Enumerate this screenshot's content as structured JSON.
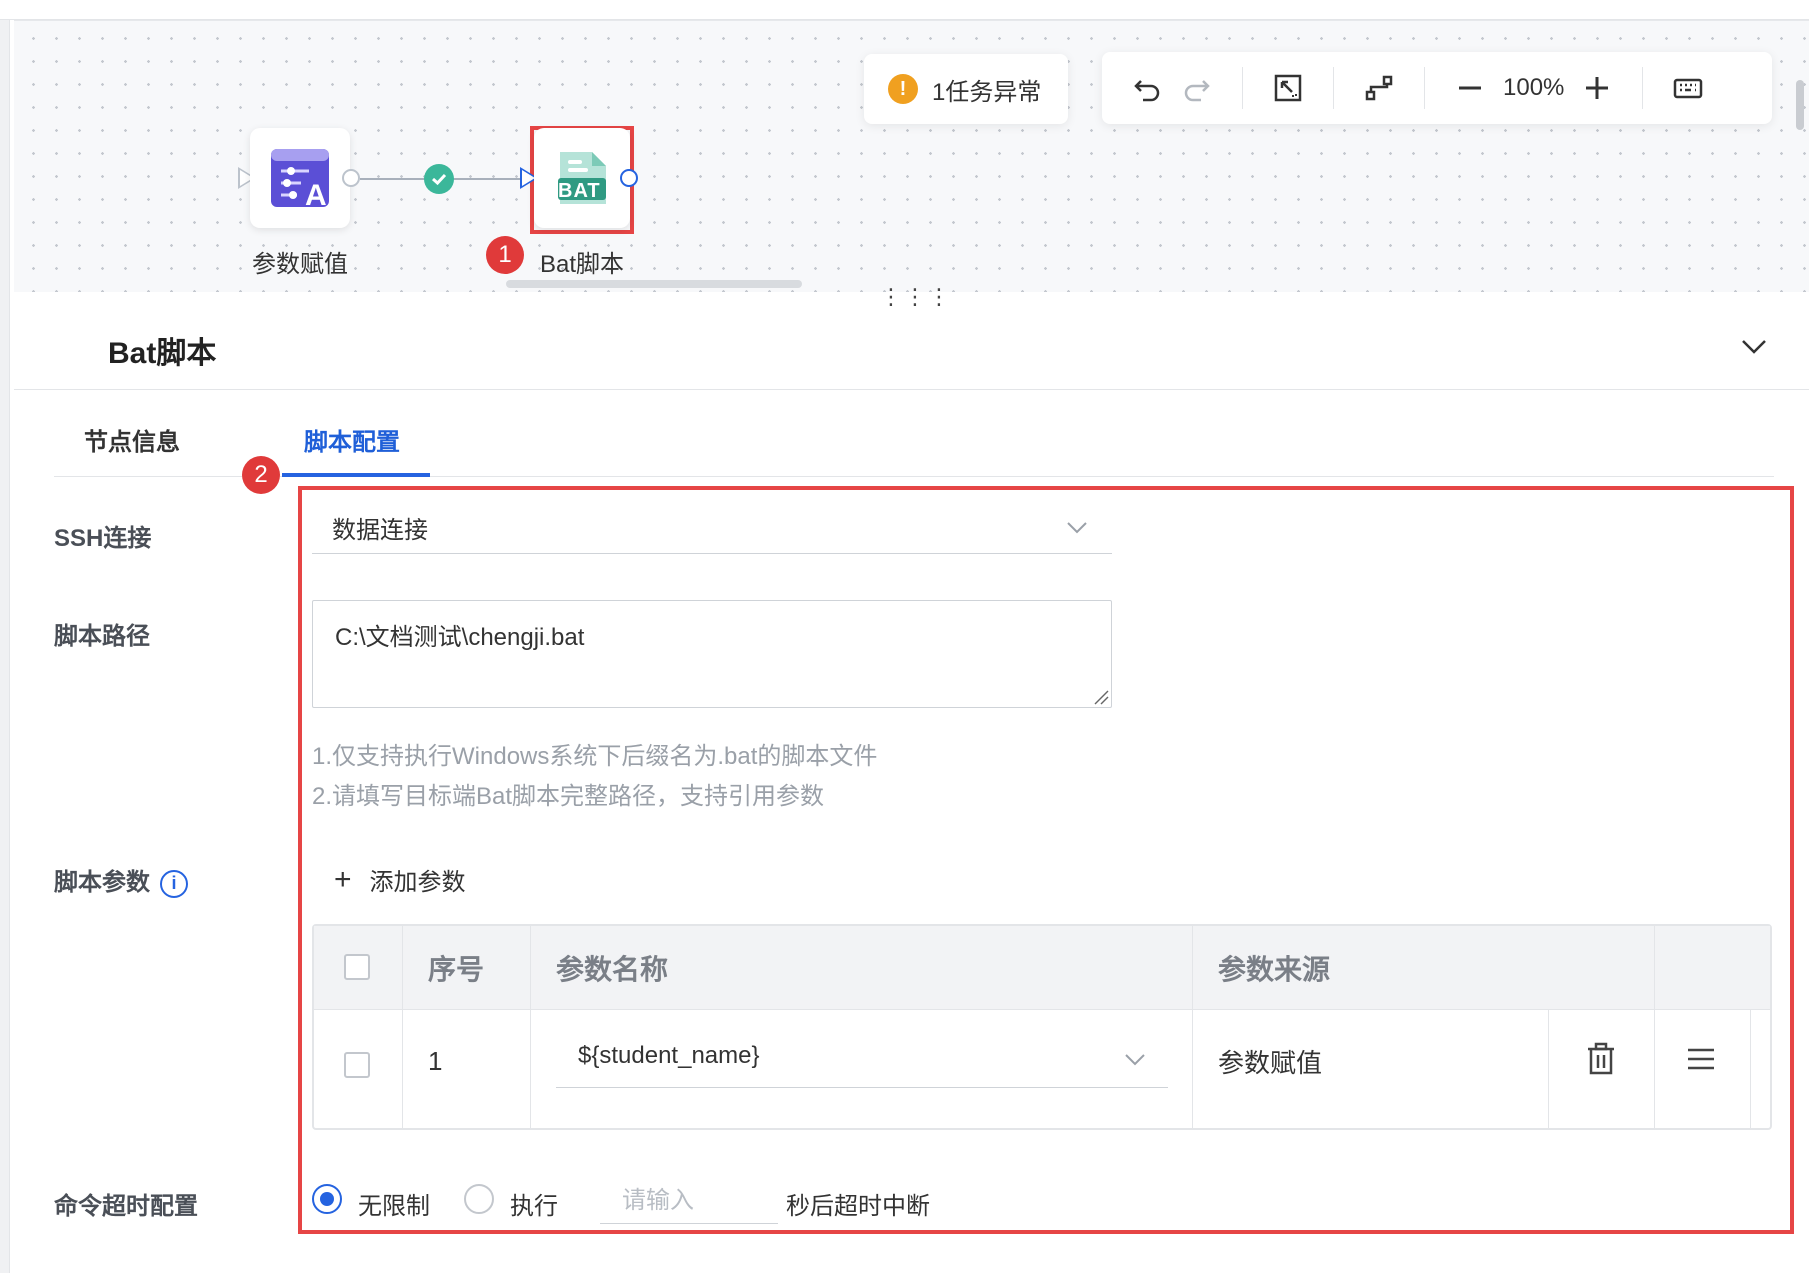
{
  "canvas": {
    "nodes": [
      {
        "label": "参数赋值",
        "icon": "param-assign-icon"
      },
      {
        "label": "Bat脚本",
        "icon": "bat-file-icon",
        "icon_text": "BAT"
      }
    ],
    "edge_status": "success",
    "annotations": [
      "1",
      "2"
    ],
    "alert_text": "1任务异常",
    "zoom": "100%"
  },
  "panel": {
    "title": "Bat脚本",
    "tabs": [
      "节点信息",
      "脚本配置"
    ],
    "active_tab": "脚本配置"
  },
  "form": {
    "ssh_label": "SSH连接",
    "ssh_value": "数据连接",
    "path_label": "脚本路径",
    "path_value": "C:\\文档测试\\chengji.bat",
    "hint1": "1.仅支持执行Windows系统下后缀名为.bat的脚本文件",
    "hint2": "2.请填写目标端Bat脚本完整路径，支持引用参数",
    "params_label": "脚本参数",
    "add_param": "添加参数",
    "table": {
      "headers": [
        "序号",
        "参数名称",
        "参数来源"
      ],
      "rows": [
        {
          "index": "1",
          "name": "${student_name}",
          "source": "参数赋值"
        }
      ]
    },
    "timeout_label": "命令超时配置",
    "timeout_options": [
      "无限制",
      "执行"
    ],
    "timeout_selected": "无限制",
    "timeout_placeholder": "请输入",
    "timeout_suffix": "秒后超时中断"
  },
  "colors": {
    "accent": "#2563e0",
    "annotation_red": "#e64545",
    "success": "#3bb79a",
    "warning": "#f0a020"
  }
}
